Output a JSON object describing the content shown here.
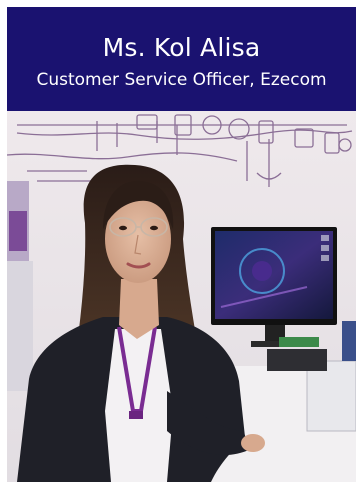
{
  "caption": {
    "name": "Ms. Kol Alisa",
    "role": "Customer Service Officer, Ezecom"
  },
  "colors": {
    "banner": "#1a1270",
    "text": "#ffffff",
    "wall": "#e9e4e6",
    "wall_drawing": "#7a5a88"
  },
  "photo": {
    "subject": "portrait-woman",
    "scene": "office-desk-with-monitor"
  }
}
